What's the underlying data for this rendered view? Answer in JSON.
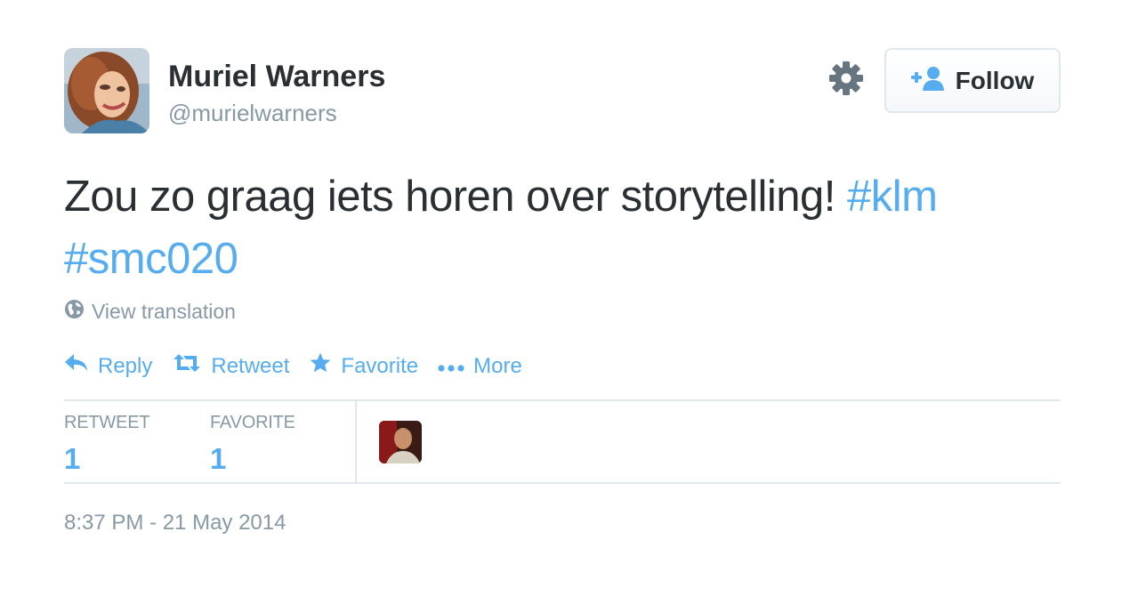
{
  "author": {
    "fullname": "Muriel Warners",
    "handle": "@murielwarners",
    "avatar_icon": "user-avatar-photo"
  },
  "header": {
    "settings_icon": "gear-icon",
    "follow_label": "Follow",
    "follow_icon": "add-user-icon"
  },
  "tweet": {
    "text": "Zou zo graag iets horen over storytelling! ",
    "hashtags": [
      "#klm",
      "#smc020"
    ]
  },
  "translation": {
    "icon": "globe-icon",
    "label": "View translation"
  },
  "actions": [
    {
      "icon": "reply-icon",
      "label": "Reply"
    },
    {
      "icon": "retweet-icon",
      "label": "Retweet"
    },
    {
      "icon": "star-icon",
      "label": "Favorite"
    },
    {
      "icon": "more-dots-icon",
      "label": "More"
    }
  ],
  "stats": {
    "retweets": {
      "label": "RETWEET",
      "count": "1"
    },
    "favorites": {
      "label": "FAVORITE",
      "count": "1"
    }
  },
  "favorited_by": [
    {
      "avatar_icon": "user-avatar-photo"
    }
  ],
  "timestamp": "8:37 PM - 21 May 2014",
  "colors": {
    "accent": "#55acee",
    "text": "#292f33",
    "muted": "#8899a6",
    "border": "#e1e8ed"
  }
}
